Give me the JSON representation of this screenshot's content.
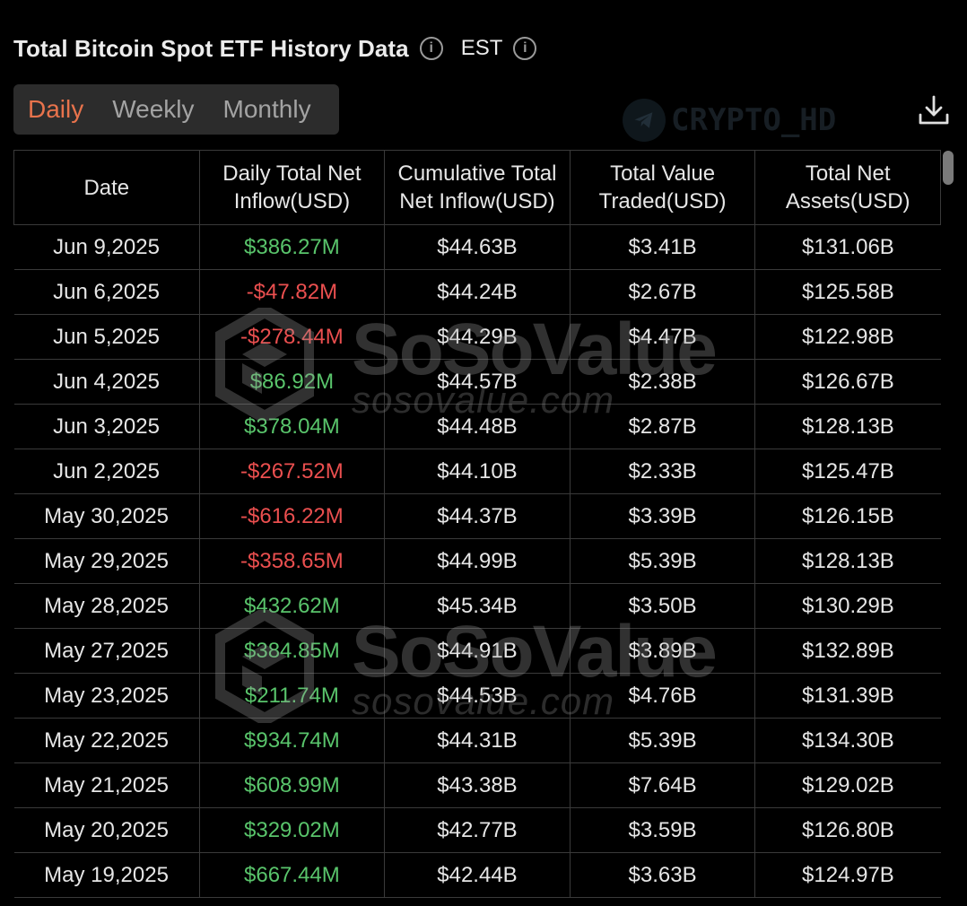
{
  "header": {
    "title": "Total Bitcoin Spot ETF History Data",
    "timezone": "EST"
  },
  "period_tabs": [
    {
      "label": "Daily",
      "active": true
    },
    {
      "label": "Weekly",
      "active": false
    },
    {
      "label": "Monthly",
      "active": false
    }
  ],
  "watermarks": {
    "top": "CRYPTO_HD",
    "brand": "SoSoValue",
    "url": "sosovalue.com"
  },
  "colors": {
    "positive": "#59c46b",
    "negative": "#ea4f4f",
    "active_tab": "#e8734c",
    "background": "#000000"
  },
  "icons": {
    "info": "info-icon",
    "download": "download-icon",
    "telegram": "telegram-icon"
  },
  "table": {
    "columns": [
      [
        "Date"
      ],
      [
        "Daily Total Net",
        "Inflow(USD)"
      ],
      [
        "Cumulative Total",
        "Net Inflow(USD)"
      ],
      [
        "Total Value",
        "Traded(USD)"
      ],
      [
        "Total Net",
        "Assets(USD)"
      ]
    ],
    "rows": [
      {
        "date": "Jun 9,2025",
        "daily": "$386.27M",
        "cumulative": "$44.63B",
        "traded": "$3.41B",
        "assets": "$131.06B",
        "sign": "pos"
      },
      {
        "date": "Jun 6,2025",
        "daily": "-$47.82M",
        "cumulative": "$44.24B",
        "traded": "$2.67B",
        "assets": "$125.58B",
        "sign": "neg"
      },
      {
        "date": "Jun 5,2025",
        "daily": "-$278.44M",
        "cumulative": "$44.29B",
        "traded": "$4.47B",
        "assets": "$122.98B",
        "sign": "neg"
      },
      {
        "date": "Jun 4,2025",
        "daily": "$86.92M",
        "cumulative": "$44.57B",
        "traded": "$2.38B",
        "assets": "$126.67B",
        "sign": "pos"
      },
      {
        "date": "Jun 3,2025",
        "daily": "$378.04M",
        "cumulative": "$44.48B",
        "traded": "$2.87B",
        "assets": "$128.13B",
        "sign": "pos"
      },
      {
        "date": "Jun 2,2025",
        "daily": "-$267.52M",
        "cumulative": "$44.10B",
        "traded": "$2.33B",
        "assets": "$125.47B",
        "sign": "neg"
      },
      {
        "date": "May 30,2025",
        "daily": "-$616.22M",
        "cumulative": "$44.37B",
        "traded": "$3.39B",
        "assets": "$126.15B",
        "sign": "neg"
      },
      {
        "date": "May 29,2025",
        "daily": "-$358.65M",
        "cumulative": "$44.99B",
        "traded": "$5.39B",
        "assets": "$128.13B",
        "sign": "neg"
      },
      {
        "date": "May 28,2025",
        "daily": "$432.62M",
        "cumulative": "$45.34B",
        "traded": "$3.50B",
        "assets": "$130.29B",
        "sign": "pos"
      },
      {
        "date": "May 27,2025",
        "daily": "$384.85M",
        "cumulative": "$44.91B",
        "traded": "$3.89B",
        "assets": "$132.89B",
        "sign": "pos"
      },
      {
        "date": "May 23,2025",
        "daily": "$211.74M",
        "cumulative": "$44.53B",
        "traded": "$4.76B",
        "assets": "$131.39B",
        "sign": "pos"
      },
      {
        "date": "May 22,2025",
        "daily": "$934.74M",
        "cumulative": "$44.31B",
        "traded": "$5.39B",
        "assets": "$134.30B",
        "sign": "pos"
      },
      {
        "date": "May 21,2025",
        "daily": "$608.99M",
        "cumulative": "$43.38B",
        "traded": "$7.64B",
        "assets": "$129.02B",
        "sign": "pos"
      },
      {
        "date": "May 20,2025",
        "daily": "$329.02M",
        "cumulative": "$42.77B",
        "traded": "$3.59B",
        "assets": "$126.80B",
        "sign": "pos"
      },
      {
        "date": "May 19,2025",
        "daily": "$667.44M",
        "cumulative": "$42.44B",
        "traded": "$3.63B",
        "assets": "$124.97B",
        "sign": "pos"
      }
    ]
  }
}
